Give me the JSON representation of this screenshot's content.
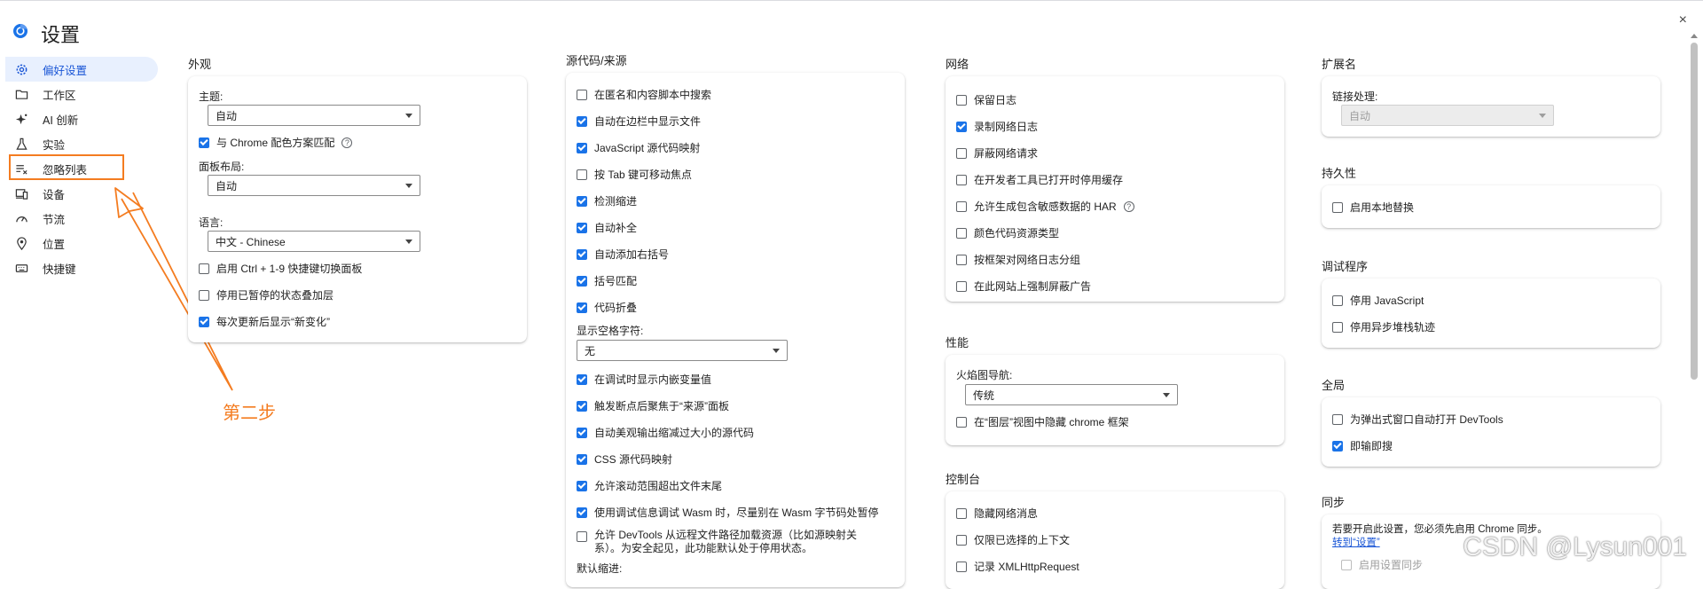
{
  "header": {
    "title": "设置",
    "close": "×"
  },
  "sidebar": {
    "items": [
      {
        "label": "偏好设置",
        "icon": "gear-icon"
      },
      {
        "label": "工作区",
        "icon": "folder-icon"
      },
      {
        "label": "AI 创新",
        "icon": "sparkle-icon"
      },
      {
        "label": "实验",
        "icon": "flask-icon"
      },
      {
        "label": "忽略列表",
        "icon": "ignore-list-icon"
      },
      {
        "label": "设备",
        "icon": "devices-icon"
      },
      {
        "label": "节流",
        "icon": "throttle-icon"
      },
      {
        "label": "位置",
        "icon": "location-icon"
      },
      {
        "label": "快捷键",
        "icon": "keyboard-icon"
      }
    ]
  },
  "annotation": {
    "text": "第二步",
    "color": "#f47c20"
  },
  "appearance": {
    "title": "外观",
    "theme_label": "主题:",
    "theme_value": "自动",
    "match_chrome": "与 Chrome 配色方案匹配",
    "panel_layout_label": "面板布局:",
    "panel_layout_value": "自动",
    "language_label": "语言:",
    "language_value": "中文 - Chinese",
    "ctrl_shortcut": "启用 Ctrl + 1-9 快捷键切换面板",
    "disable_paused_overlay": "停用已暂停的状态叠加层",
    "show_whats_new": "每次更新后显示“新变化”"
  },
  "sources": {
    "title": "源代码/来源",
    "items": [
      {
        "label": "在匿名和内容脚本中搜索",
        "checked": false
      },
      {
        "label": "自动在边栏中显示文件",
        "checked": true
      },
      {
        "label": "JavaScript 源代码映射",
        "checked": true
      },
      {
        "label": "按 Tab 键可移动焦点",
        "checked": false
      },
      {
        "label": "检测缩进",
        "checked": true
      },
      {
        "label": "自动补全",
        "checked": true
      },
      {
        "label": "自动添加右括号",
        "checked": true
      },
      {
        "label": "括号匹配",
        "checked": true
      },
      {
        "label": "代码折叠",
        "checked": true
      }
    ],
    "whitespace_label": "显示空格字符:",
    "whitespace_value": "无",
    "items2": [
      {
        "label": "在调试时显示内嵌变量值",
        "checked": true
      },
      {
        "label": "触发断点后聚焦于“来源”面板",
        "checked": true
      },
      {
        "label": "自动美观输出缩减过大小的源代码",
        "checked": true
      },
      {
        "label": "CSS 源代码映射",
        "checked": true
      },
      {
        "label": "允许滚动范围超出文件末尾",
        "checked": true
      },
      {
        "label": "使用调试信息调试 Wasm 时，尽量别在 Wasm 字节码处暂停",
        "checked": true
      }
    ],
    "remote_line1": "允许 DevTools 从远程文件路径加载资源（比如源映射关",
    "remote_line2": "系）。为安全起见，此功能默认处于停用状态。",
    "default_indent_label": "默认缩进:"
  },
  "network": {
    "title": "网络",
    "items": [
      {
        "label": "保留日志",
        "checked": false
      },
      {
        "label": "录制网络日志",
        "checked": true
      },
      {
        "label": "屏蔽网络请求",
        "checked": false
      },
      {
        "label": "在开发者工具已打开时停用缓存",
        "checked": false
      },
      {
        "label": "允许生成包含敏感数据的 HAR",
        "checked": false
      },
      {
        "label": "颜色代码资源类型",
        "checked": false
      },
      {
        "label": "按框架对网络日志分组",
        "checked": false
      },
      {
        "label": "在此网站上强制屏蔽广告",
        "checked": false
      }
    ]
  },
  "performance": {
    "title": "性能",
    "flame_label": "火焰图导航:",
    "flame_value": "传统",
    "hide_chrome_frames": "在“图层”视图中隐藏 chrome 框架"
  },
  "console": {
    "title": "控制台",
    "items": [
      {
        "label": "隐藏网络消息",
        "checked": false
      },
      {
        "label": "仅限已选择的上下文",
        "checked": false
      },
      {
        "label": "记录 XMLHttpRequest",
        "checked": false
      }
    ]
  },
  "extensions": {
    "title": "扩展名",
    "link_handling_label": "链接处理:",
    "link_handling_value": "自动"
  },
  "persistence": {
    "title": "持久性",
    "local_overrides": "启用本地替换"
  },
  "debugger": {
    "title": "调试程序",
    "disable_js": "停用 JavaScript",
    "disable_async": "停用异步堆栈轨迹"
  },
  "global": {
    "title": "全局",
    "auto_open_popups": "为弹出式窗口自动打开 DevTools",
    "search_as_type": "即输即搜"
  },
  "sync": {
    "title": "同步",
    "message": "若要开启此设置，您必须先启用 Chrome 同步。",
    "link": "转到“设置”",
    "enable_sync": "启用设置同步"
  },
  "watermark": "CSDN @Lysun001"
}
